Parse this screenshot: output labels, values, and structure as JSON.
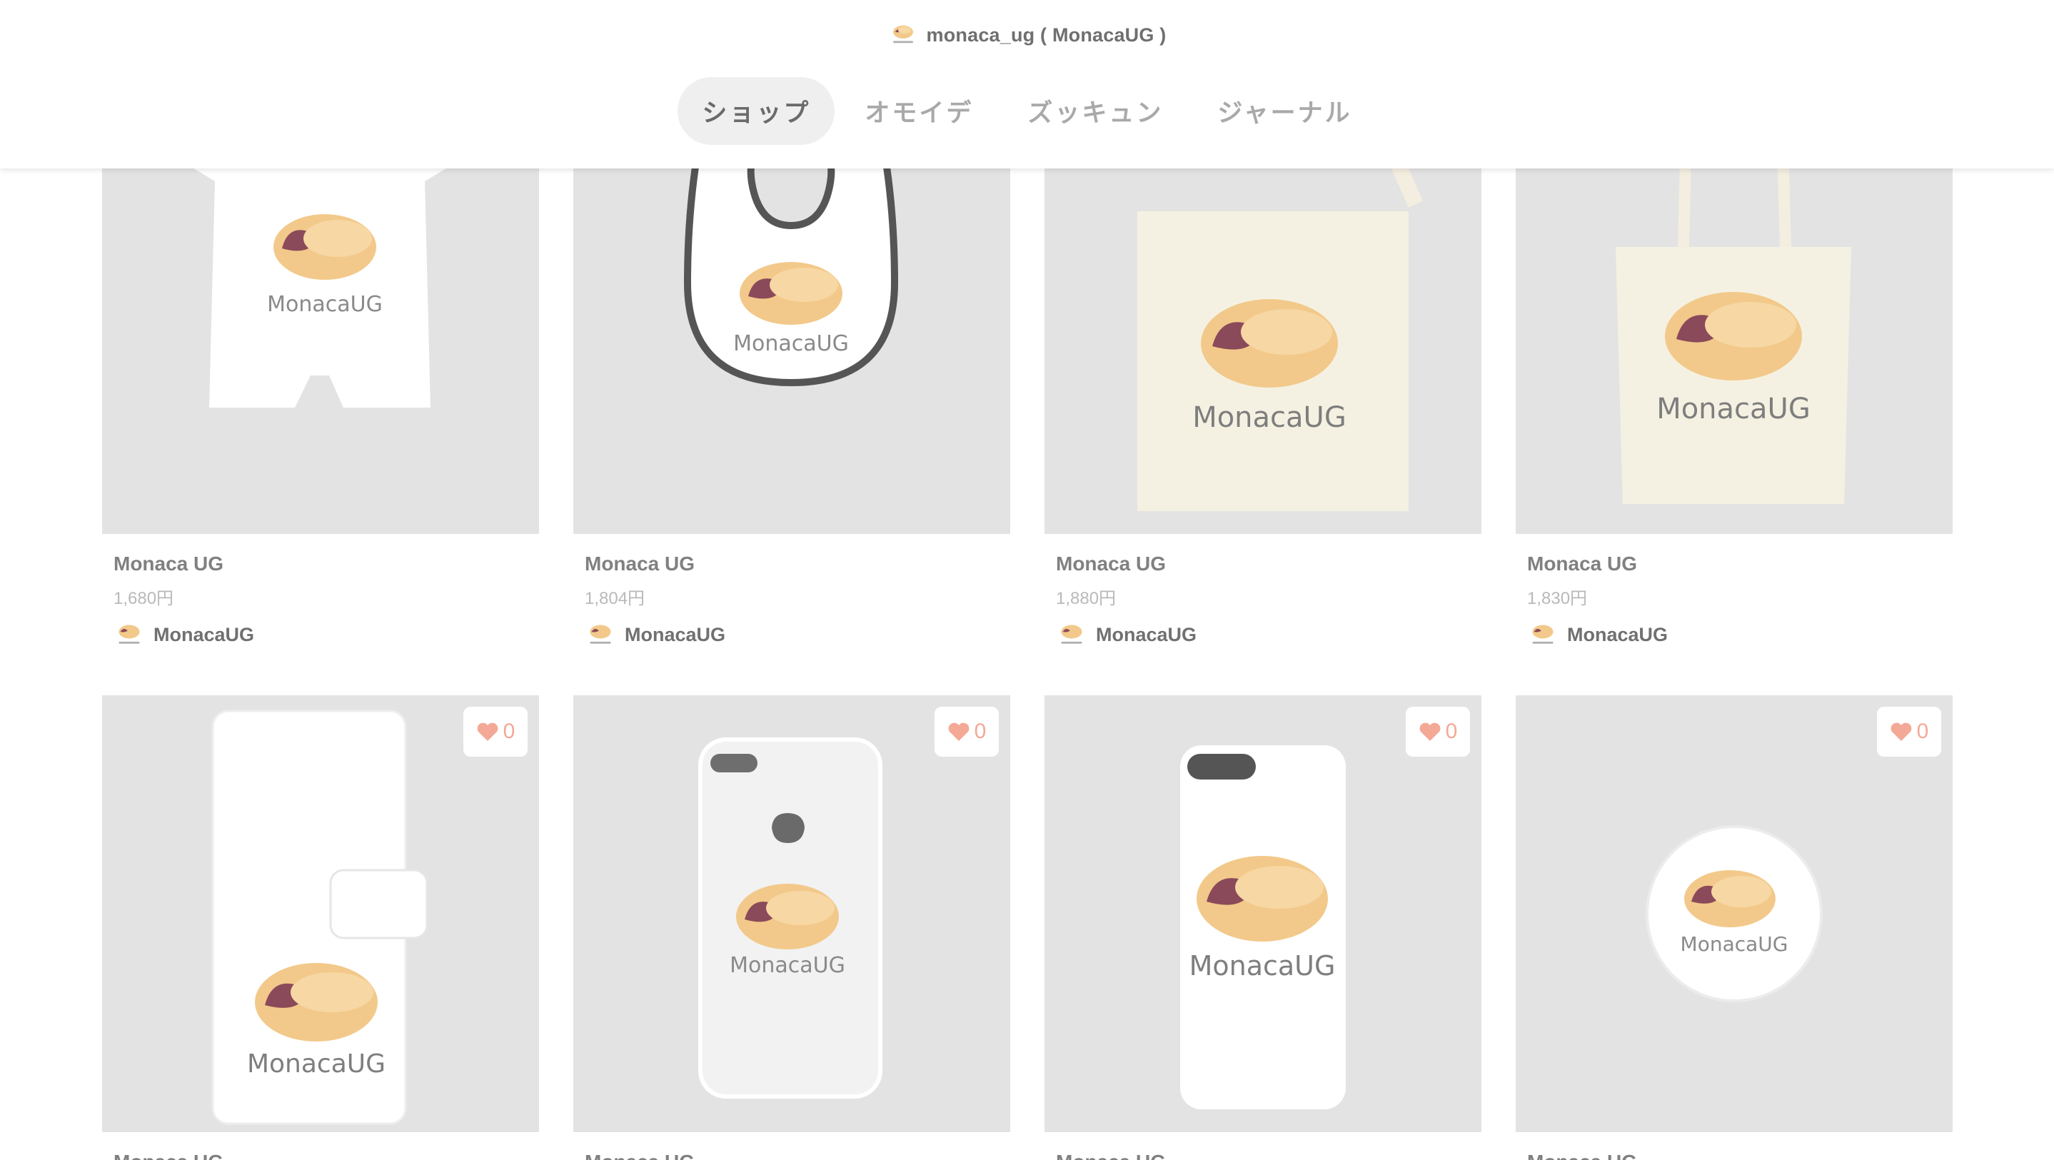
{
  "header": {
    "account_label": "monaca_ug ( MonacaUG )",
    "tabs": [
      {
        "label": "ショップ",
        "active": true
      },
      {
        "label": "オモイデ",
        "active": false
      },
      {
        "label": "ズッキュン",
        "active": false
      },
      {
        "label": "ジャーナル",
        "active": false
      }
    ]
  },
  "brand_text": "MonacaUG",
  "products_row1": [
    {
      "type": "baby-rompers",
      "title": "Monaca UG",
      "price": "1,680円",
      "seller": "MonacaUG"
    },
    {
      "type": "bib",
      "title": "Monaca UG",
      "price": "1,804円",
      "seller": "MonacaUG"
    },
    {
      "type": "sacoche",
      "title": "Monaca UG",
      "price": "1,880円",
      "seller": "MonacaUG"
    },
    {
      "type": "tote-bag",
      "title": "Monaca UG",
      "price": "1,830円",
      "seller": "MonacaUG"
    }
  ],
  "products_row2": [
    {
      "type": "notebook-smartphone-case",
      "likes": "0",
      "title": "Monaca UG"
    },
    {
      "type": "clear-iphone-case",
      "likes": "0",
      "title": "Monaca UG"
    },
    {
      "type": "iphone-case",
      "likes": "0",
      "title": "Monaca UG"
    },
    {
      "type": "can-badge",
      "likes": "0",
      "title": "Monaca UG"
    }
  ],
  "colors": {
    "thumb_bg": "#e3e3e3",
    "monaca_wafer": "#f2c98a",
    "monaca_bean": "#8a4a5a",
    "like_heart": "#f3a996",
    "tab_active_bg": "#efefef"
  }
}
